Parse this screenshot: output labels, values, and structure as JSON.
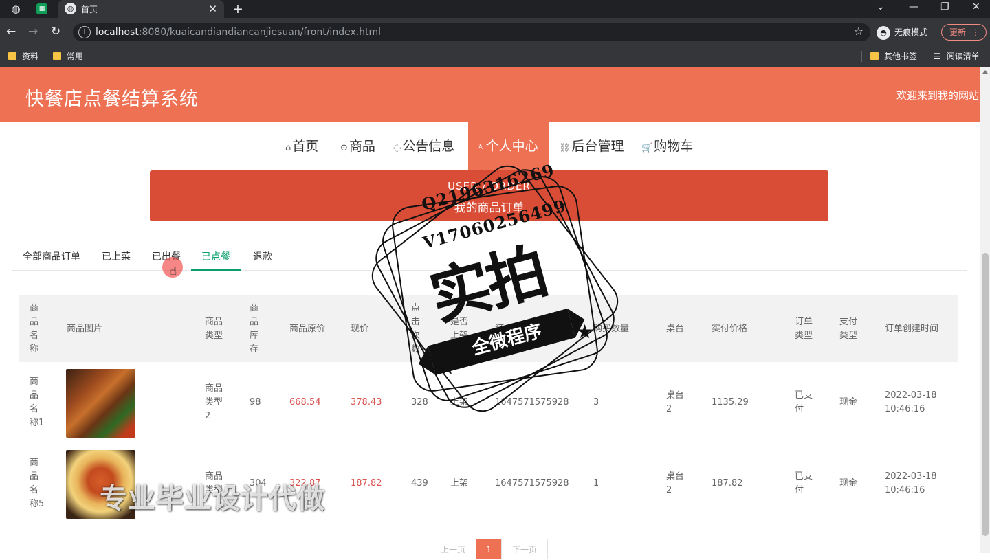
{
  "browser": {
    "tab_title": "首页",
    "url_host": "localhost",
    "url_rest": ":8080/kuaicandiandiancanjiesuan/front/index.html",
    "incognito_label": "无痕模式",
    "update_label": "更新",
    "bookmarks": [
      "资料",
      "常用"
    ],
    "bookmarks_right": [
      "其他书签",
      "阅读清单"
    ]
  },
  "site": {
    "title": "快餐店点餐结算系统",
    "welcome": "欢迎来到我的网站",
    "accent_color": "#ee7154"
  },
  "nav": [
    {
      "icon": "home-icon",
      "glyph": "⌂",
      "label": "首页"
    },
    {
      "icon": "goods-icon",
      "glyph": "⊙",
      "label": "商品"
    },
    {
      "icon": "notice-icon",
      "glyph": "◌",
      "label": "公告信息"
    },
    {
      "icon": "user-icon",
      "glyph": "♙",
      "label": "个人中心"
    },
    {
      "icon": "link-icon",
      "glyph": "⛓",
      "label": "后台管理"
    },
    {
      "icon": "cart-icon",
      "glyph": "🛒",
      "label": "购物车"
    }
  ],
  "banner": {
    "en": "USER / ORDER",
    "cn": "我的商品订单"
  },
  "tabs": [
    "全部商品订单",
    "已上菜",
    "已出餐",
    "已点餐",
    "退款"
  ],
  "active_tab": "已点餐",
  "table": {
    "headers": [
      "商品名称",
      "商品图片",
      "商品类型",
      "商品库存",
      "商品原价",
      "现价",
      "点击次数",
      "是否上架",
      "订单号",
      "购买数量",
      "桌台",
      "实付价格",
      "订单类型",
      "支付类型",
      "订单创建时间"
    ],
    "rows": [
      {
        "name": "商品名称1",
        "image": "grilled-meat-photo",
        "type": "商品类型2",
        "stock": "98",
        "orig_price": "668.54",
        "price": "378.43",
        "clicks": "328",
        "shelf": "上架",
        "order_no": "1647571575928",
        "qty": "3",
        "table_no": "桌台2",
        "paid": "1135.29",
        "order_type": "已支付",
        "pay_type": "现金",
        "created": "2022-03-18 10:46:16"
      },
      {
        "name": "商品名称5",
        "image": "noodles-photo",
        "type": "商品类型",
        "stock": "304",
        "orig_price": "322.87",
        "price": "187.82",
        "clicks": "439",
        "shelf": "上架",
        "order_no": "1647571575928",
        "qty": "1",
        "table_no": "桌台2",
        "paid": "187.82",
        "order_type": "已支付",
        "pay_type": "现金",
        "created": "2022-03-18 10:46:16"
      }
    ]
  },
  "pagination": {
    "prev": "上一页",
    "current": "1",
    "next": "下一页"
  },
  "overlay": {
    "contact_q": "Q2196316269",
    "contact_v": "V17060256499",
    "stamp_main": "实拍",
    "stamp_ribbon": "全微程序",
    "promo": "专业毕业设计代做"
  }
}
